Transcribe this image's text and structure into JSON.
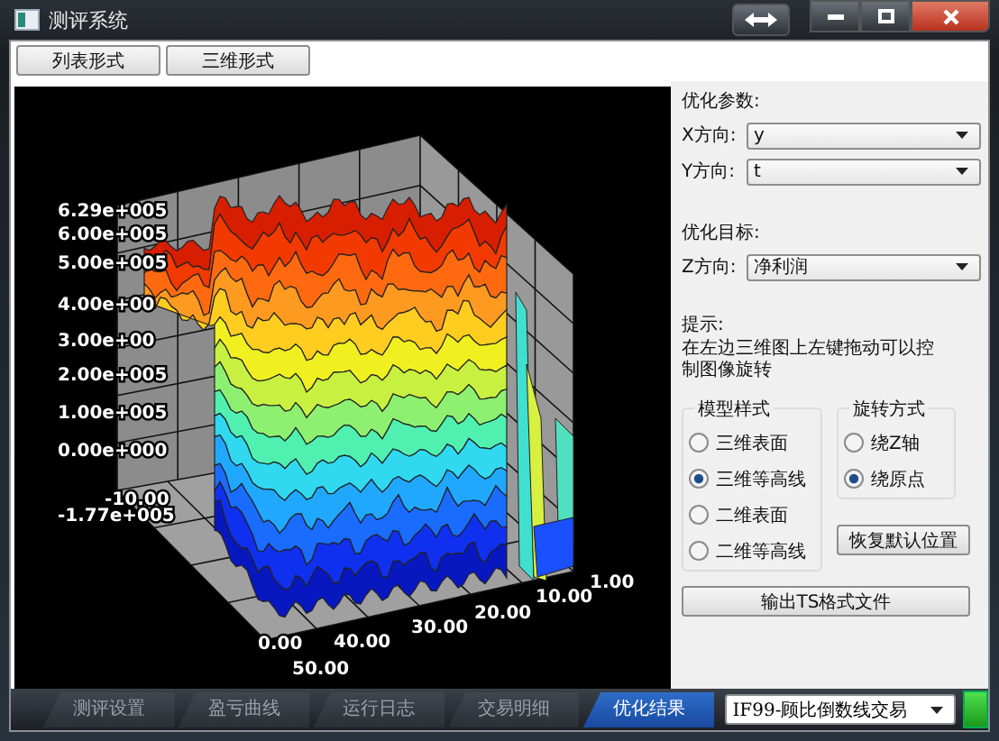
{
  "window": {
    "title": "测评系统"
  },
  "view_buttons": [
    {
      "label": "列表形式"
    },
    {
      "label": "三维形式"
    }
  ],
  "plot": {
    "z_axis_labels": [
      "6.29e+005",
      "6.00e+005",
      "5.00e+005",
      "4.00e+00",
      "3.00e+00",
      "2.00e+005",
      "1.00e+005",
      "0.00e+000",
      "-1.77e+005"
    ],
    "x_axis_labels": [
      "-10.00",
      "0.00"
    ],
    "y_axis_labels": [
      "50.00",
      "40.00",
      "30.00",
      "20.00",
      "10.00",
      "1.00"
    ]
  },
  "panel": {
    "params_title": "优化参数:",
    "axes": [
      {
        "label": "X方向:",
        "value": "y"
      },
      {
        "label": "Y方向:",
        "value": "t"
      }
    ],
    "target_title": "优化目标:",
    "target": {
      "label": "Z方向:",
      "value": "净利润"
    },
    "hint_title": "提示:",
    "hint": "在左边三维图上左键拖动可以控制图像旋转",
    "model_style": {
      "title": "模型样式",
      "options": [
        {
          "label": "三维表面",
          "selected": false
        },
        {
          "label": "三维等高线",
          "selected": true
        },
        {
          "label": "二维表面",
          "selected": false
        },
        {
          "label": "二维等高线",
          "selected": false
        }
      ]
    },
    "rotation": {
      "title": "旋转方式",
      "options": [
        {
          "label": "绕Z轴",
          "selected": false
        },
        {
          "label": "绕原点",
          "selected": true
        }
      ]
    },
    "reset_button": "恢复默认位置",
    "export_button": "输出TS格式文件"
  },
  "tabs": [
    {
      "label": "测评设置",
      "selected": false
    },
    {
      "label": "盈亏曲线",
      "selected": false
    },
    {
      "label": "运行日志",
      "selected": false
    },
    {
      "label": "交易明细",
      "selected": false
    },
    {
      "label": "优化结果",
      "selected": true
    }
  ],
  "strategy": {
    "value": "IF99-顾比倒数线交易"
  }
}
